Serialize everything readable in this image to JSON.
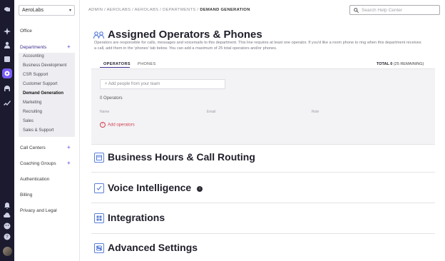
{
  "rail": {
    "icons": [
      "logo-icon",
      "sparkle-icon",
      "person-icon",
      "contacts-icon",
      "gear-icon",
      "headset-icon",
      "analytics-icon",
      "bell-icon",
      "cloud-icon",
      "smiley-icon",
      "help-icon"
    ],
    "accent": "#7a5cf5",
    "background": "#1b1a2e"
  },
  "sidebar": {
    "org_select": "AeroLabs",
    "office_label": "Office",
    "departments_label": "Departments",
    "departments": [
      "Accounting",
      "Business Development",
      "CSR Support",
      "Customer Support",
      "Demand Generation",
      "Marketing",
      "Recruiting",
      "Sales",
      "Sales & Support"
    ],
    "call_centers_label": "Call Centers",
    "coaching_groups_label": "Coaching Groups",
    "authentication_label": "Authentication",
    "billing_label": "Billing",
    "privacy_label": "Privacy and Legal"
  },
  "breadcrumb": {
    "path": "ADMIN / AEROLABS / AEROLABS / DEPARTMENTS / ",
    "current": "DEMAND GENERATION"
  },
  "search": {
    "placeholder": "Search Help Center"
  },
  "main": {
    "title": "Assigned Operators & Phones",
    "description": "Operators are responsible for calls, messages and voicemails to this department. This line requires at least one operator. If you'd like a room phone to ring when this department receives a call, add them in the 'phones' tab below. You can add a maximum of 25 total operators and/or phones.",
    "tabs": [
      "OPERATORS",
      "PHONES"
    ],
    "total_label": "TOTAL 0",
    "total_remaining": " (25 REMAINING)",
    "add_placeholder": "+ Add people from your team",
    "operator_count": "0 Operators",
    "columns": [
      "Name",
      "Email",
      "Role"
    ],
    "add_operators_label": "Add operators"
  },
  "sections": [
    {
      "title": "Business Hours & Call Routing",
      "icon": "calendar-icon"
    },
    {
      "title": "Voice Intelligence",
      "icon": "checklist-icon"
    },
    {
      "title": "Integrations",
      "icon": "grid-icon"
    },
    {
      "title": "Advanced Settings",
      "icon": "toggle-icon"
    }
  ]
}
